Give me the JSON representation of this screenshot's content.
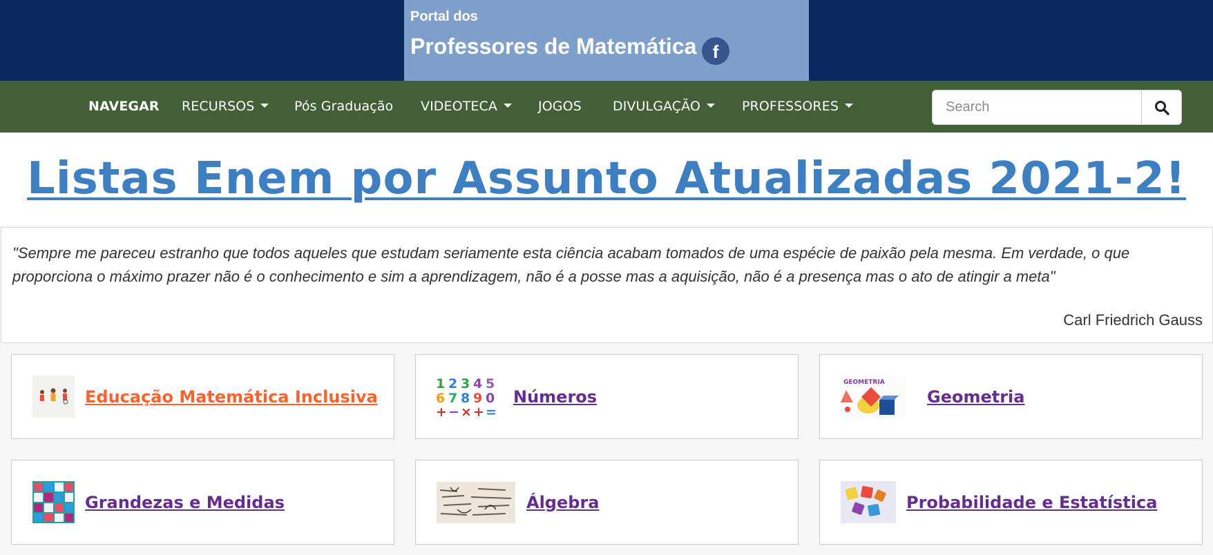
{
  "header": {
    "small_title": "Portal dos",
    "big_title": "Professores de Matemática",
    "facebook_glyph": "f"
  },
  "nav": {
    "items": [
      {
        "label": "NAVEGAR",
        "dropdown": false,
        "active": true
      },
      {
        "label": "RECURSOS",
        "dropdown": true
      },
      {
        "label": "Pós Graduação",
        "dropdown": false
      },
      {
        "label": "VIDEOTECA",
        "dropdown": true
      },
      {
        "label": "JOGOS",
        "dropdown": false
      },
      {
        "label": "DIVULGAÇÃO",
        "dropdown": true
      },
      {
        "label": "PROFESSORES",
        "dropdown": true
      }
    ],
    "search_placeholder": "Search"
  },
  "banner": {
    "title": "Listas Enem por Assunto Atualizadas 2021-2!"
  },
  "quote": {
    "text": "\"Sempre me pareceu estranho que todos aqueles que estudam seriamente esta ciência acabam tomados de uma espécie de paixão pela mesma. Em verdade, o que proporciona o máximo prazer não é o conhecimento e sim a aprendizagem, não é a posse mas a aquisição, não é a presença mas o ato de atingir a meta\"",
    "author": "Carl Friedrich Gauss"
  },
  "cards": [
    {
      "label": "Educação Matemática Inclusiva",
      "icon": "inclusive-education-thumbnail"
    },
    {
      "label": "Números",
      "icon": "numbers-thumbnail"
    },
    {
      "label": "Geometria",
      "icon": "geometry-thumbnail"
    },
    {
      "label": "Grandezas e Medidas",
      "icon": "measures-thumbnail"
    },
    {
      "label": "Álgebra",
      "icon": "algebra-thumbnail"
    },
    {
      "label": "Probabilidade e Estatística",
      "icon": "probability-thumbnail"
    }
  ],
  "colors": {
    "header_bg": "#0b2860",
    "brand_bg": "#7f9fcb",
    "nav_bg": "#425f37",
    "banner_text": "#3d7fc0",
    "link_purple": "#662d91",
    "link_orange": "#f26532"
  }
}
